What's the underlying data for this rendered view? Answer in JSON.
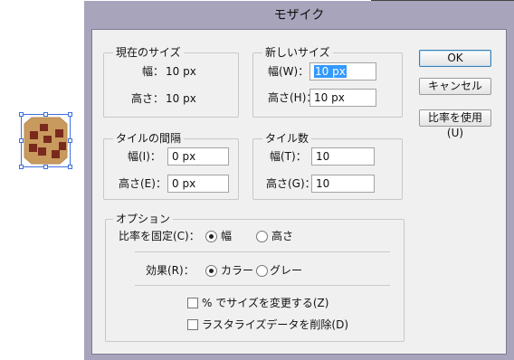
{
  "dialog": {
    "title": "モザイク",
    "buttons": {
      "ok": "OK",
      "cancel": "キャンセル",
      "use_ratio": "比率を使用(U)"
    }
  },
  "current_size": {
    "title": "現在のサイズ",
    "width_label": "幅：",
    "width_value": "10 px",
    "height_label": "高さ：",
    "height_value": "10 px"
  },
  "new_size": {
    "title": "新しいサイズ",
    "width_label": "幅(W)：",
    "width_value": "10 px",
    "height_label": "高さ(H)：",
    "height_value": "10 px"
  },
  "tile_spacing": {
    "title": "タイルの間隔",
    "width_label": "幅(I)：",
    "width_value": "0 px",
    "height_label": "高さ(E)：",
    "height_value": "0 px"
  },
  "tile_count": {
    "title": "タイル数",
    "width_label": "幅(T)：",
    "width_value": "10",
    "height_label": "高さ(G)：",
    "height_value": "10"
  },
  "options": {
    "title": "オプション",
    "fix_ratio_label": "比率を固定(C)：",
    "fix_ratio_options": [
      "幅",
      "高さ"
    ],
    "fix_ratio_selected": "幅",
    "effect_label": "効果(R)：",
    "effect_options": [
      "カラー",
      "グレー"
    ],
    "effect_selected": "カラー",
    "checkbox_percent": "% でサイズを変更する(Z)",
    "checkbox_percent_checked": false,
    "checkbox_rasterize": "ラスタライズデータを削除(D)",
    "checkbox_rasterize_checked": false
  },
  "colors": {
    "dialog_frame": "#a7a4bc",
    "client_bg": "#f0f0f0",
    "selection_blue": "#3d6fe0",
    "cookie_base": "#c89a5e",
    "cookie_chips": "#7a2a1c"
  }
}
